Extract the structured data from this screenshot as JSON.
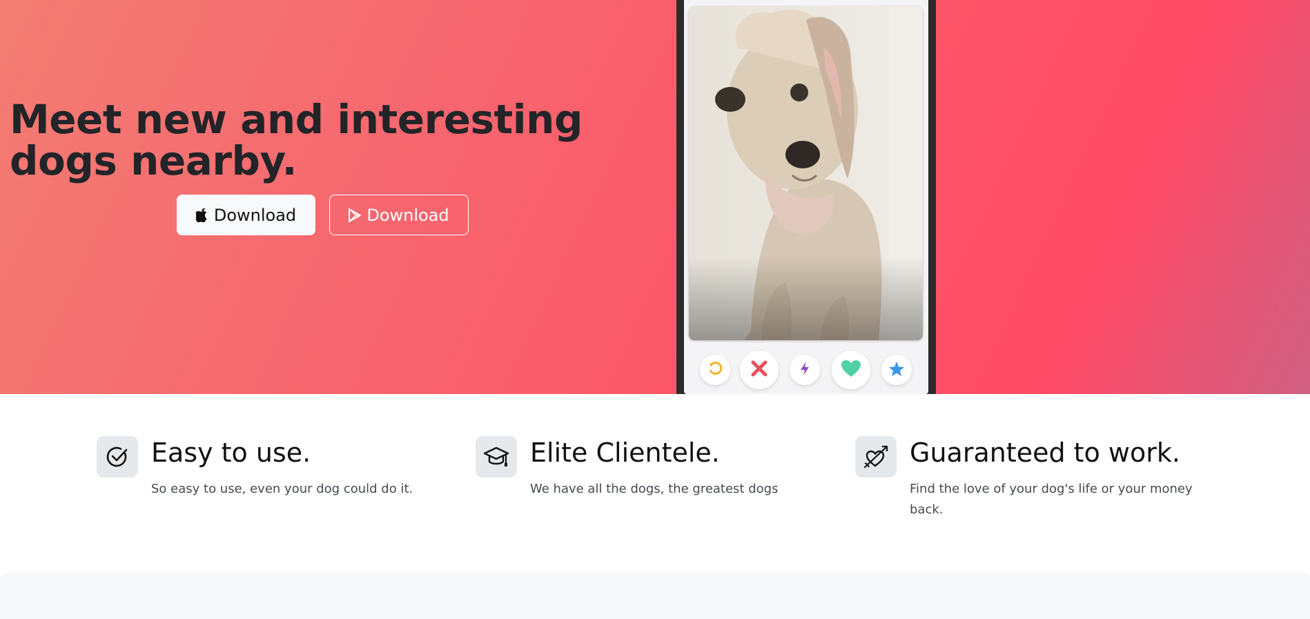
{
  "hero": {
    "headline": "Meet new and interesting dogs nearby.",
    "buttons": [
      {
        "label": "Download",
        "icon": "apple-icon"
      },
      {
        "label": "Download",
        "icon": "google-play-icon"
      }
    ],
    "gradient_colors": [
      "#f37d73",
      "#fb5b6a",
      "#ff4a66",
      "#d05f82"
    ]
  },
  "phone": {
    "actions": [
      {
        "name": "rewind-icon",
        "color": "#f5b62a"
      },
      {
        "name": "nope-x-icon",
        "color": "#e8505b"
      },
      {
        "name": "boost-lightning-icon",
        "color": "#8f4ac0"
      },
      {
        "name": "like-heart-icon",
        "color": "#4fd1a5"
      },
      {
        "name": "super-like-star-icon",
        "color": "#3e96e8"
      }
    ]
  },
  "features": [
    {
      "icon": "checkmark-circle-icon",
      "title": "Easy to use.",
      "description": "So easy to use, even your dog could do it."
    },
    {
      "icon": "graduation-cap-icon",
      "title": "Elite Clientele.",
      "description": "We have all the dogs, the greatest dogs"
    },
    {
      "icon": "heart-arrow-icon",
      "title": "Guaranteed to work.",
      "description": "Find the love of your dog's life or your money back."
    }
  ]
}
